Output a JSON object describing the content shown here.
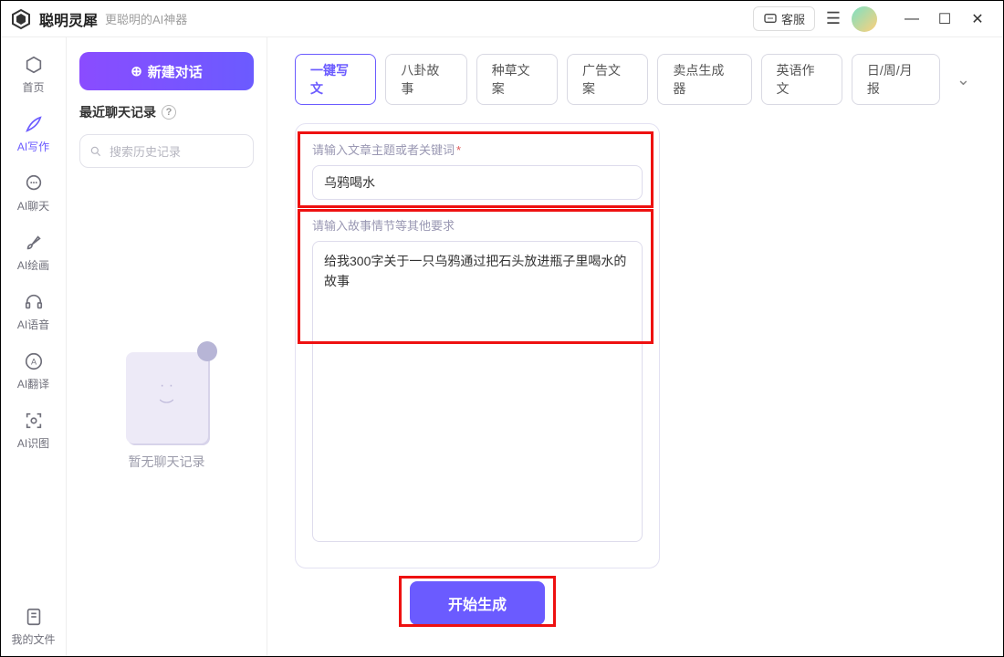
{
  "title": {
    "app_name": "聪明灵犀",
    "tagline": "更聪明的AI神器",
    "customer_service": "客服"
  },
  "sidebar": {
    "items": [
      {
        "label": "首页",
        "icon": "home"
      },
      {
        "label": "AI写作",
        "icon": "pen"
      },
      {
        "label": "AI聊天",
        "icon": "chat"
      },
      {
        "label": "AI绘画",
        "icon": "brush"
      },
      {
        "label": "AI语音",
        "icon": "audio"
      },
      {
        "label": "AI翻译",
        "icon": "translate"
      },
      {
        "label": "AI识图",
        "icon": "scan"
      }
    ],
    "bottom": {
      "label": "我的文件",
      "icon": "file"
    }
  },
  "col2": {
    "new_chat": "新建对话",
    "history_title": "最近聊天记录",
    "search_placeholder": "搜索历史记录",
    "empty_text": "暂无聊天记录"
  },
  "tabs": {
    "items": [
      "一键写文",
      "八卦故事",
      "种草文案",
      "广告文案",
      "卖点生成器",
      "英语作文",
      "日/周/月报"
    ],
    "active_index": 0
  },
  "form": {
    "field1_label": "请输入文章主题或者关键词",
    "field1_value": "乌鸦喝水",
    "field2_label": "请输入故事情节等其他要求",
    "field2_value": "给我300字关于一只乌鸦通过把石头放进瓶子里喝水的故事",
    "generate": "开始生成"
  }
}
